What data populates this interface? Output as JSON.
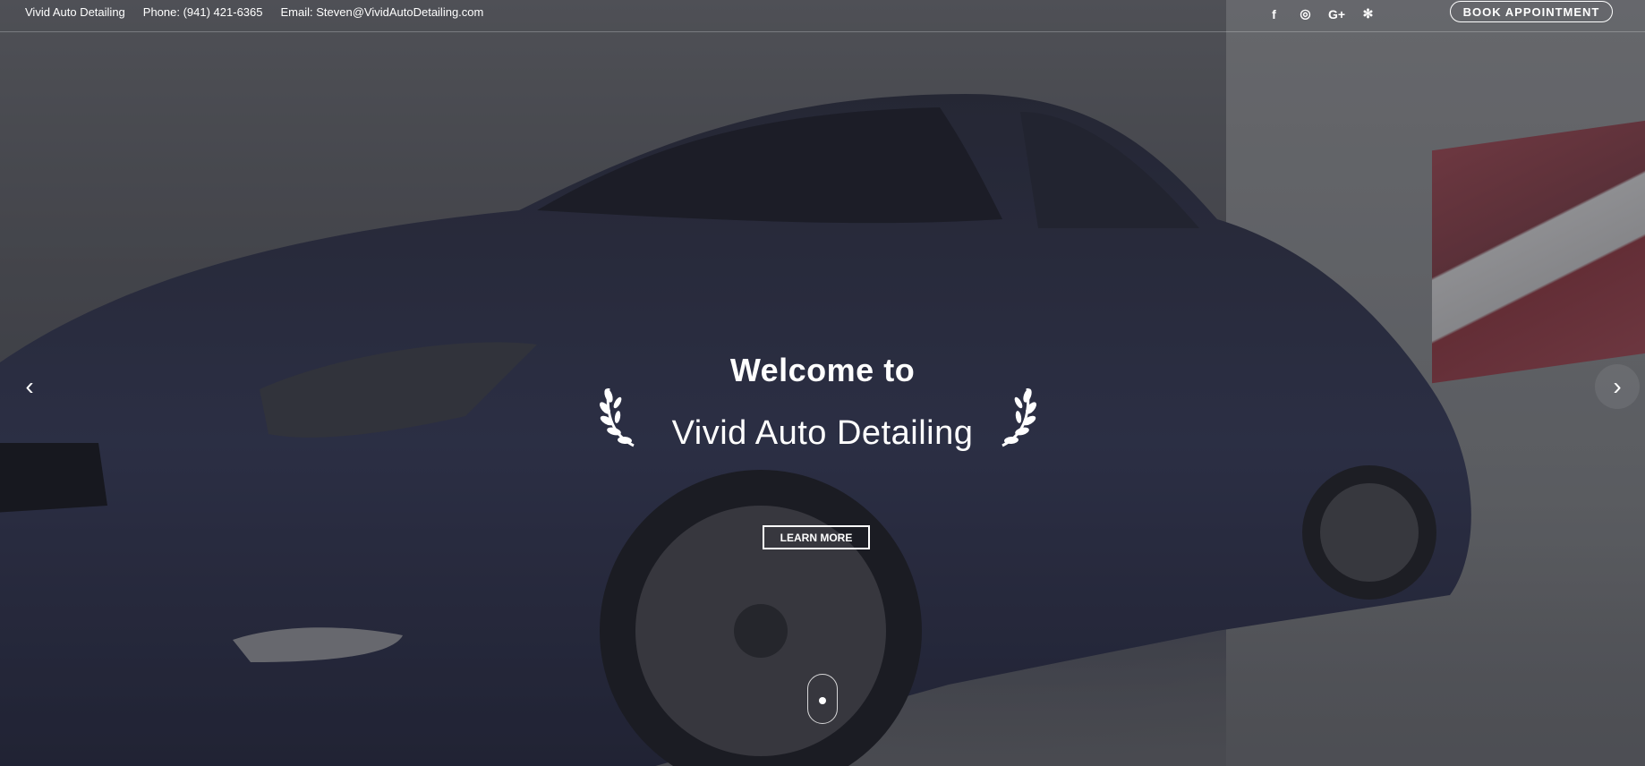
{
  "topbar": {
    "business_name": "Vivid Auto Detailing",
    "phone": "Phone: (941) 421-6365",
    "email": "Email: Steven@VividAutoDetailing.com",
    "socials": [
      {
        "icon": "facebook-icon",
        "glyph": "f"
      },
      {
        "icon": "instagram-icon",
        "glyph": "◎"
      },
      {
        "icon": "google-plus-icon",
        "glyph": "G+"
      },
      {
        "icon": "yelp-icon",
        "glyph": "✻"
      }
    ],
    "book_label": "BOOK APPOINTMENT"
  },
  "hero": {
    "welcome": "Welcome to",
    "brand": "Vivid Auto Detailing",
    "cta_label": "LEARN MORE",
    "prev_glyph": "‹",
    "next_glyph": "›"
  }
}
